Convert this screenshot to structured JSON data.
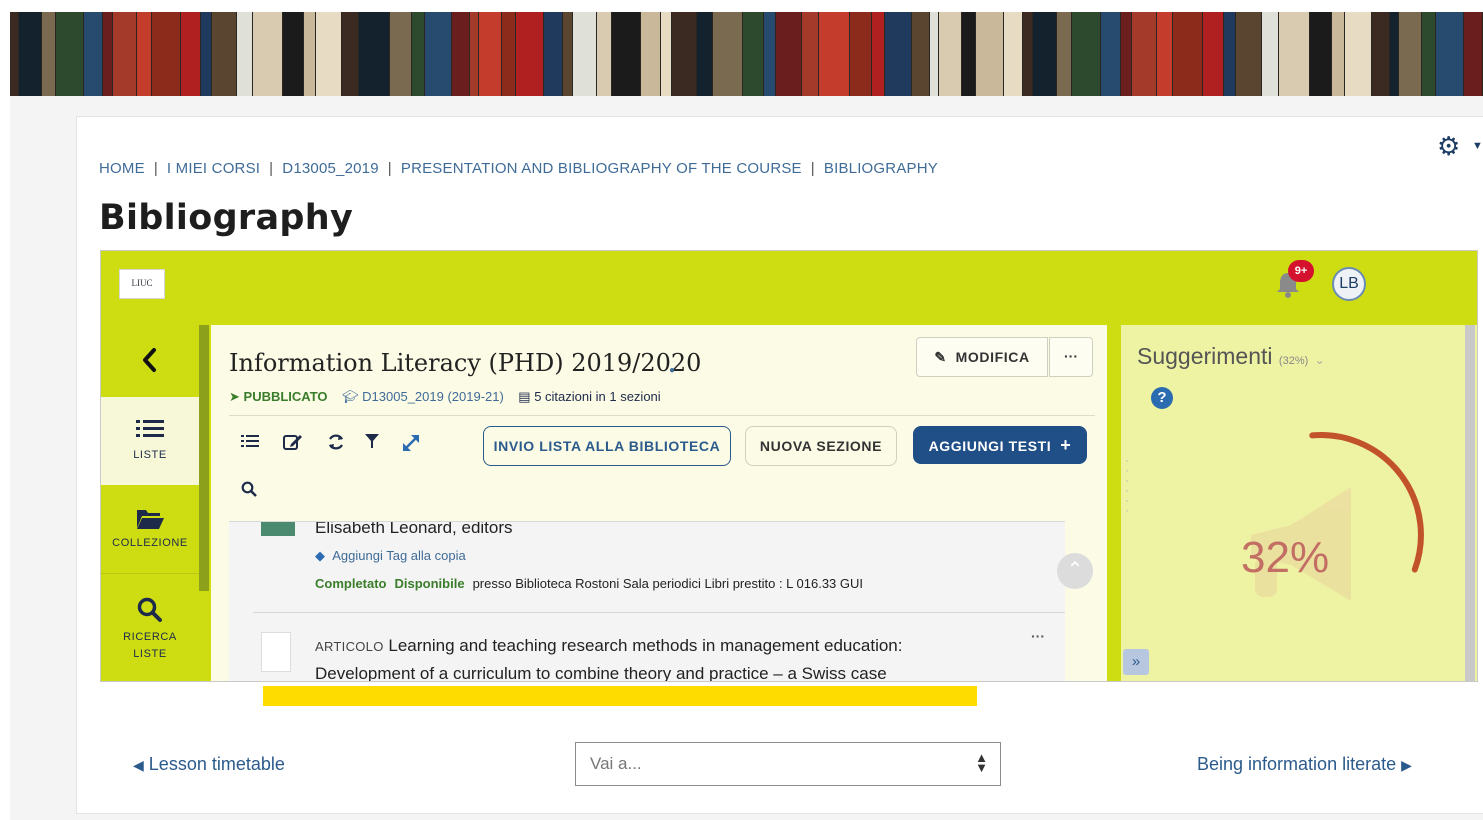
{
  "breadcrumb": [
    "HOME",
    "I MIEI CORSI",
    "D13005_2019",
    "PRESENTATION AND BIBLIOGRAPHY OF THE COURSE",
    "BIBLIOGRAPHY"
  ],
  "page_title": "Bibliography",
  "app": {
    "logo_text": "LIUC",
    "notification_badge": "9+",
    "avatar_initials": "LB",
    "nav": {
      "back_icon": "chevron-left-icon",
      "items": [
        {
          "label": "LISTE",
          "icon": "list-icon"
        },
        {
          "label": "COLLEZIONE",
          "icon": "folder-open-icon"
        },
        {
          "label": "RICERCA\nLISTE",
          "icon": "search-icon"
        }
      ]
    },
    "list": {
      "title": "Information Literacy (PHD) 2019/2020",
      "status": "PUBBLICATO",
      "course": "D13005_2019 (2019-21)",
      "citations": "5 citazioni in 1 sezioni",
      "modifica_label": "MODIFICA",
      "more_label": "···",
      "invio_label": "INVIO LISTA ALLA BIBLIOTECA",
      "nuova_label": "NUOVA SEZIONE",
      "aggiungi_label": "AGGIUNGI TESTI"
    },
    "items": [
      {
        "author": "Elisabeth Leonard, editors",
        "tag_link": "Aggiungi Tag alla copia",
        "status_completed": "Completato",
        "status_available": "Disponibile",
        "location": "presso Biblioteca Rostoni Sala periodici Libri prestito : L 016.33 GUI"
      },
      {
        "kind": "ARTICOLO",
        "title": "Learning and teaching research methods in management education: Development of a curriculum to combine theory and practice – a Swiss case"
      }
    ],
    "suggestions": {
      "title": "Suggerimenti",
      "percent_small": "(32%)",
      "value_label": "32%",
      "progress": 0.32
    }
  },
  "footer": {
    "prev_label": "Lesson timetable",
    "jump_placeholder": "Vai a...",
    "next_label": "Being information literate"
  },
  "colors": {
    "accent_green": "#cddd12",
    "primary_blue": "#1f4f86",
    "highlight_yellow": "#ffdc00"
  }
}
